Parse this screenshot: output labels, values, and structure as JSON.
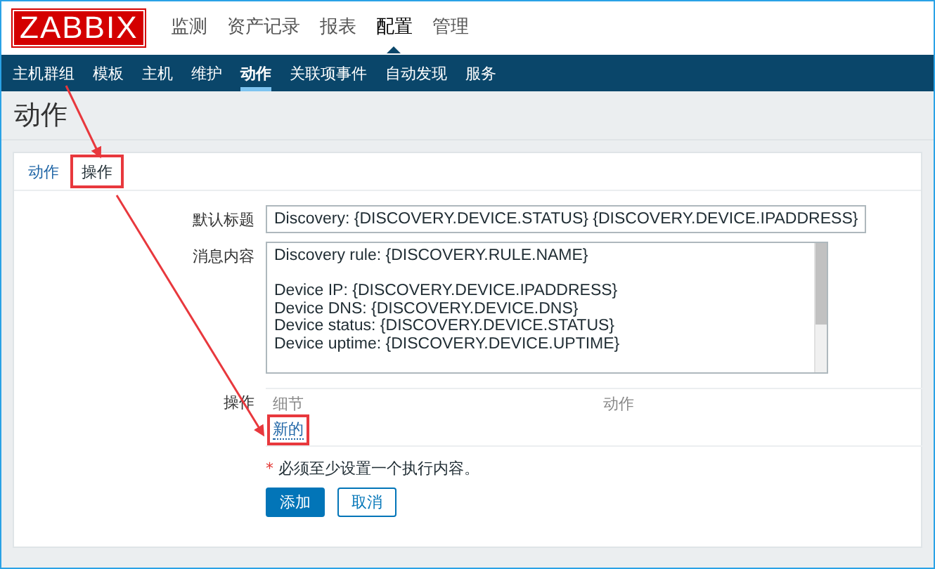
{
  "logo": "ZABBIX",
  "top_menu": [
    {
      "label": "监测",
      "selected": false
    },
    {
      "label": "资产记录",
      "selected": false
    },
    {
      "label": "报表",
      "selected": false
    },
    {
      "label": "配置",
      "selected": true
    },
    {
      "label": "管理",
      "selected": false
    }
  ],
  "sub_menu": [
    {
      "label": "主机群组",
      "selected": false
    },
    {
      "label": "模板",
      "selected": false
    },
    {
      "label": "主机",
      "selected": false
    },
    {
      "label": "维护",
      "selected": false
    },
    {
      "label": "动作",
      "selected": true
    },
    {
      "label": "关联项事件",
      "selected": false
    },
    {
      "label": "自动发现",
      "selected": false
    },
    {
      "label": "服务",
      "selected": false
    }
  ],
  "page_title": "动作",
  "tabs": [
    {
      "label": "动作",
      "selected": false,
      "highlighted": false
    },
    {
      "label": "操作",
      "selected": true,
      "highlighted": true
    }
  ],
  "form": {
    "default_subject": {
      "label": "默认标题",
      "value": "Discovery: {DISCOVERY.DEVICE.STATUS} {DISCOVERY.DEVICE.IPADDRESS}"
    },
    "message": {
      "label": "消息内容",
      "paragraphs": [
        [
          "Discovery rule: {DISCOVERY.RULE.NAME}"
        ],
        [
          "Device IP: {DISCOVERY.DEVICE.IPADDRESS}",
          "Device DNS: {DISCOVERY.DEVICE.DNS}",
          "Device status: {DISCOVERY.DEVICE.STATUS}",
          "Device uptime: {DISCOVERY.DEVICE.UPTIME}"
        ]
      ]
    },
    "operations": {
      "label": "操作",
      "columns": [
        "细节",
        "动作"
      ],
      "new_link": {
        "label": "新的",
        "highlighted": true
      }
    },
    "required_note": {
      "mark": "*",
      "text": "必须至少设置一个执行内容。"
    },
    "buttons": [
      {
        "label": "添加",
        "kind": "primary"
      },
      {
        "label": "取消",
        "kind": "secondary"
      }
    ]
  }
}
